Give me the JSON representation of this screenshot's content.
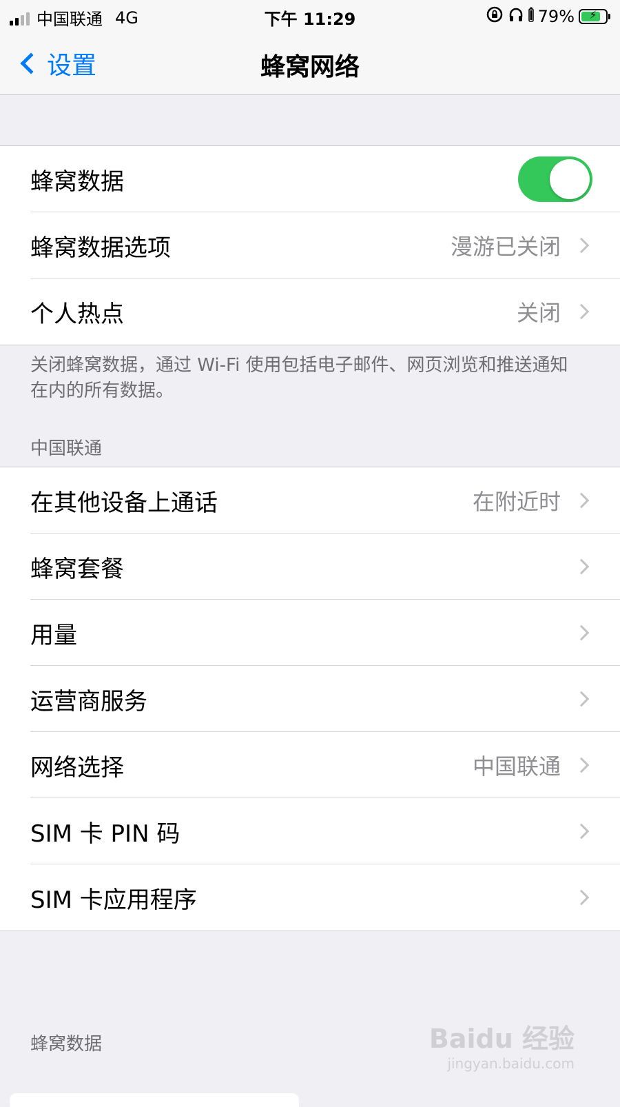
{
  "status_bar": {
    "carrier": "中国联通",
    "network": "4G",
    "time": "下午 11:29",
    "battery_percent": "79%",
    "battery_level": 0.79
  },
  "nav": {
    "back_label": "设置",
    "title": "蜂窝网络"
  },
  "group1": {
    "cellular_data": {
      "label": "蜂窝数据",
      "toggle_on": true
    },
    "cellular_data_options": {
      "label": "蜂窝数据选项",
      "value": "漫游已关闭"
    },
    "personal_hotspot": {
      "label": "个人热点",
      "value": "关闭"
    }
  },
  "group1_footer": "关闭蜂窝数据，通过 Wi-Fi 使用包括电子邮件、网页浏览和推送通知在内的所有数据。",
  "section_carrier": "中国联通",
  "group2": {
    "calls_other_devices": {
      "label": "在其他设备上通话",
      "value": "在附近时"
    },
    "cellular_plan": {
      "label": "蜂窝套餐"
    },
    "usage": {
      "label": "用量"
    },
    "carrier_services": {
      "label": "运营商服务"
    },
    "network_selection": {
      "label": "网络选择",
      "value": "中国联通"
    },
    "sim_pin": {
      "label": "SIM 卡 PIN 码"
    },
    "sim_apps": {
      "label": "SIM 卡应用程序"
    }
  },
  "section_cellular_data": "蜂窝数据",
  "watermark": {
    "main": "Baidu 经验",
    "sub": "jingyan.baidu.com"
  },
  "colors": {
    "accent": "#007aff",
    "toggle_on": "#34c759",
    "background": "#efeff4"
  }
}
